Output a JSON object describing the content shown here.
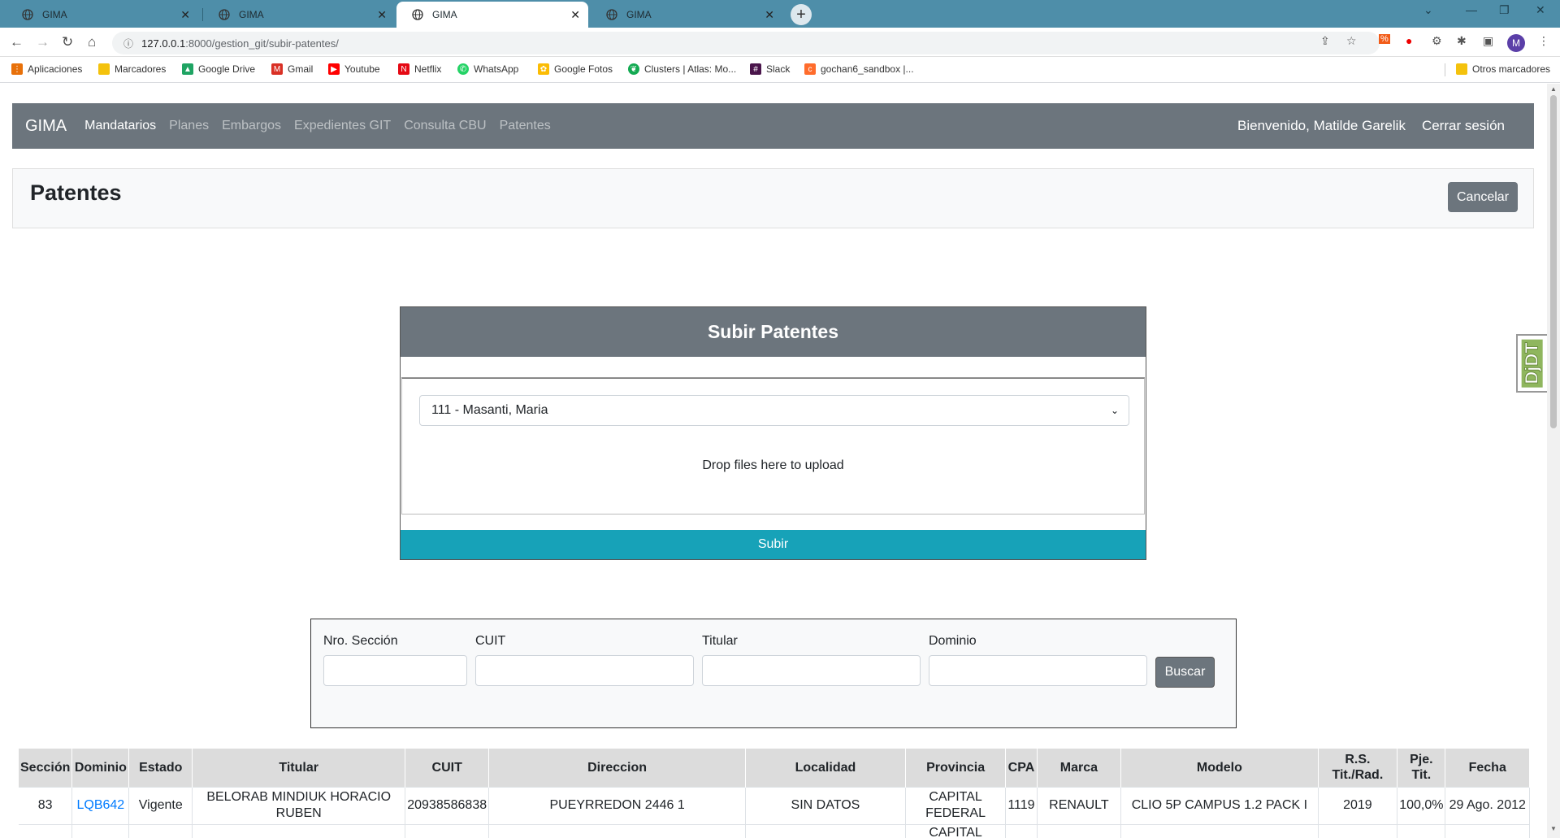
{
  "browser": {
    "tabs": [
      {
        "title": "GIMA",
        "active": false
      },
      {
        "title": "GIMA",
        "active": false
      },
      {
        "title": "GIMA",
        "active": true
      },
      {
        "title": "GIMA",
        "active": false
      }
    ],
    "url_host": "127.0.0.1",
    "url_path": ":8000/gestion_git/subir-patentes/",
    "avatar_letter": "M",
    "bookmarks": [
      {
        "label": "Aplicaciones",
        "icon": "apps-grid-icon",
        "color": "#e8710a"
      },
      {
        "label": "Marcadores",
        "icon": "folder-icon",
        "color": "#f4c20d"
      },
      {
        "label": "Google Drive",
        "icon": "drive-icon",
        "color": "#1fa463"
      },
      {
        "label": "Gmail",
        "icon": "gmail-icon",
        "color": "#d93025"
      },
      {
        "label": "Youtube",
        "icon": "youtube-icon",
        "color": "#ff0000"
      },
      {
        "label": "Netflix",
        "icon": "netflix-icon",
        "color": "#e50914"
      },
      {
        "label": "WhatsApp",
        "icon": "whatsapp-icon",
        "color": "#25d366"
      },
      {
        "label": "Google Fotos",
        "icon": "photos-icon",
        "color": "#fbbc04"
      },
      {
        "label": "Clusters | Atlas: Mo...",
        "icon": "mongodb-icon",
        "color": "#13aa52"
      },
      {
        "label": "Slack",
        "icon": "slack-icon",
        "color": "#4a154b"
      },
      {
        "label": "gochan6_sandbox |...",
        "icon": "cpanel-icon",
        "color": "#ff6c2c"
      }
    ],
    "other_bookmarks": "Otros marcadores"
  },
  "navbar": {
    "brand": "GIMA",
    "links": [
      "Mandatarios",
      "Planes",
      "Embargos",
      "Expedientes GIT",
      "Consulta CBU",
      "Patentes"
    ],
    "active_link": "Mandatarios",
    "welcome": "Bienvenido, Matilde Garelik",
    "logout": "Cerrar sesión"
  },
  "header": {
    "title": "Patentes",
    "cancel": "Cancelar"
  },
  "upload": {
    "title": "Subir Patentes",
    "selected_option": "111 - Masanti, Maria",
    "drop_text": "Drop files here to upload",
    "submit": "Subir"
  },
  "search": {
    "labels": {
      "seccion": "Nro. Sección",
      "cuit": "CUIT",
      "titular": "Titular",
      "dominio": "Dominio"
    },
    "button": "Buscar"
  },
  "table": {
    "headers": [
      "Sección",
      "Dominio",
      "Estado",
      "Titular",
      "CUIT",
      "Direccion",
      "Localidad",
      "Provincia",
      "CPA",
      "Marca",
      "Modelo",
      "R.S. Tit./Rad.",
      "Pje. Tit.",
      "Fecha"
    ],
    "rows": [
      [
        "83",
        "LQB642",
        "Vigente",
        "BELORAB MINDIUK HORACIO RUBEN",
        "20938586838",
        "PUEYRREDON 2446 1",
        "SIN DATOS",
        "CAPITAL FEDERAL",
        "1119",
        "RENAULT",
        "CLIO 5P CAMPUS 1.2 PACK I",
        "2019",
        "100,0%",
        "29 Ago. 2012"
      ],
      [
        "",
        "",
        "",
        "",
        "",
        "",
        "",
        "CAPITAL",
        "",
        "",
        "",
        "",
        "",
        ""
      ]
    ]
  },
  "debug_toolbar": "DjDT"
}
